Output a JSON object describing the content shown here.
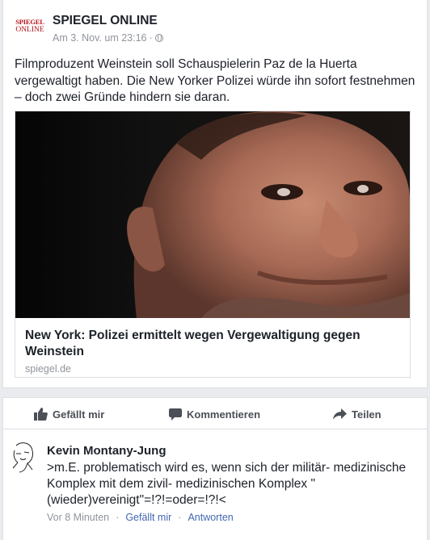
{
  "post": {
    "page_logo_line1": "SPIEGEL",
    "page_logo_line2": "ONLINE",
    "page_name": "SPIEGEL ONLINE",
    "timestamp": "Am 3. Nov. um 23:16",
    "privacy_icon": "globe-icon",
    "text": "Filmproduzent Weinstein soll Schauspielerin Paz de la Huerta vergewaltigt haben. Die New Yorker Polizei würde ihn sofort festnehmen – doch zwei Gründe hindern sie daran.",
    "link": {
      "title": "New York: Polizei ermittelt wegen Vergewaltigung gegen Weinstein",
      "domain": "spiegel.de"
    }
  },
  "actions": {
    "like_label": "Gefällt mir",
    "comment_label": "Kommentieren",
    "share_label": "Teilen",
    "like_icon": "thumbs-up-icon",
    "comment_icon": "speech-bubble-icon",
    "share_icon": "share-arrow-icon"
  },
  "comment": {
    "author": "Kevin Montany-Jung",
    "text": ">m.E. problematisch wird es, wenn sich der militär- medizinische Komplex mit dem zivil- medizinischen Komplex \"(wieder)vereinigt\"=!?!=oder=!?!<",
    "time": "Vor 8 Minuten",
    "like_label": "Gefällt mir",
    "reply_label": "Antworten",
    "separator": "·"
  },
  "colors": {
    "brand_red": "#b5121b",
    "link_blue": "#4267b2",
    "meta_gray": "#90949c"
  }
}
